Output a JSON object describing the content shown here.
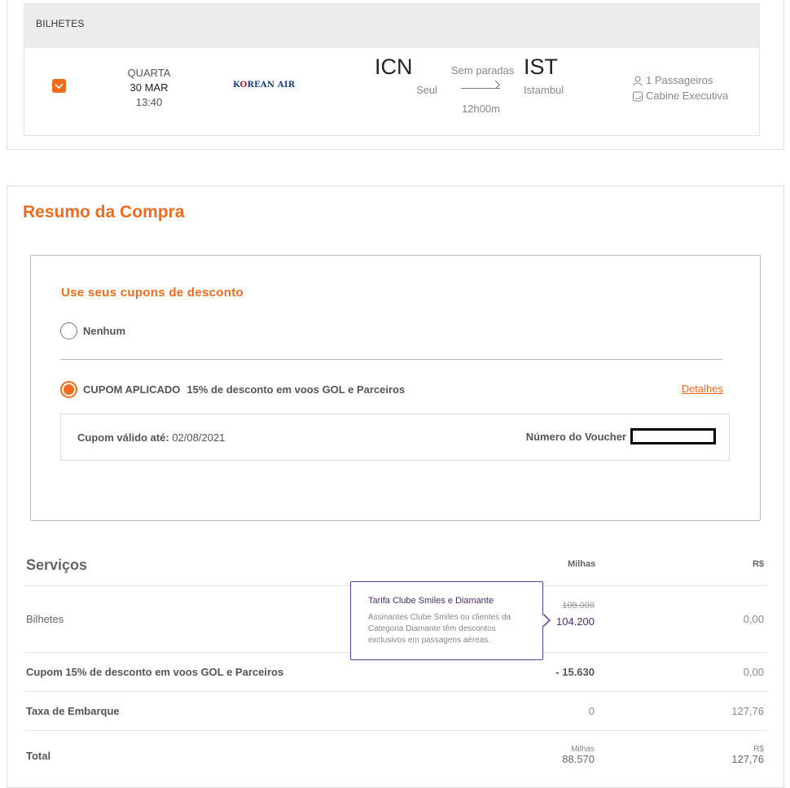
{
  "tickets": {
    "header": "BILHETES",
    "flight": {
      "weekday": "QUARTA",
      "date": "30 MAR",
      "time": "13:40",
      "airline": {
        "name_part1": "K",
        "name_o": "O",
        "name_part2": "REAN AIR",
        "icon": "korean-air-logo"
      },
      "origin_code": "ICN",
      "origin_city": "Seul",
      "stops": "Sem paradas",
      "duration": "12h00m",
      "destination_code": "IST",
      "destination_city": "Istambul",
      "passengers": "1 Passageiros",
      "cabin": "Cabine Executiva"
    }
  },
  "summary": {
    "title": "Resumo da Compra",
    "coupons": {
      "title": "Use seus cupons de desconto",
      "option_none": "Nenhum",
      "applied_label": "CUPOM APLICADO",
      "applied_desc": "15% de desconto em voos GOL e Parceiros",
      "details_link": "Detalhes",
      "valid_until_label": "Cupom válido até:",
      "valid_until_value": "02/08/2021",
      "voucher_label": "Número do Voucher"
    },
    "services": {
      "title": "Serviços",
      "col_miles": "Milhas",
      "col_brl": "R$",
      "rows": [
        {
          "label": "Bilhetes",
          "miles_old": "108.000",
          "miles": "104.200",
          "brl": "0,00"
        },
        {
          "label": "Cupom 15% de desconto em voos GOL e Parceiros",
          "miles": "- 15.630",
          "brl": "0,00"
        },
        {
          "label": "Taxa de Embarque",
          "miles": "0",
          "brl": "127,76"
        }
      ],
      "total": {
        "label": "Total",
        "miles_head": "Milhas",
        "miles": "88.570",
        "brl_head": "R$",
        "brl": "127,76"
      }
    },
    "tooltip": {
      "title": "Tarifa Clube Smiles e Diamante",
      "text": "Assinantes Clube Smiles ou clientes da Categoria Diamante têm descontos exclusivos em passagens aéreas."
    }
  },
  "colors": {
    "accent": "#f26b1d",
    "purple": "#4b2a7a"
  }
}
